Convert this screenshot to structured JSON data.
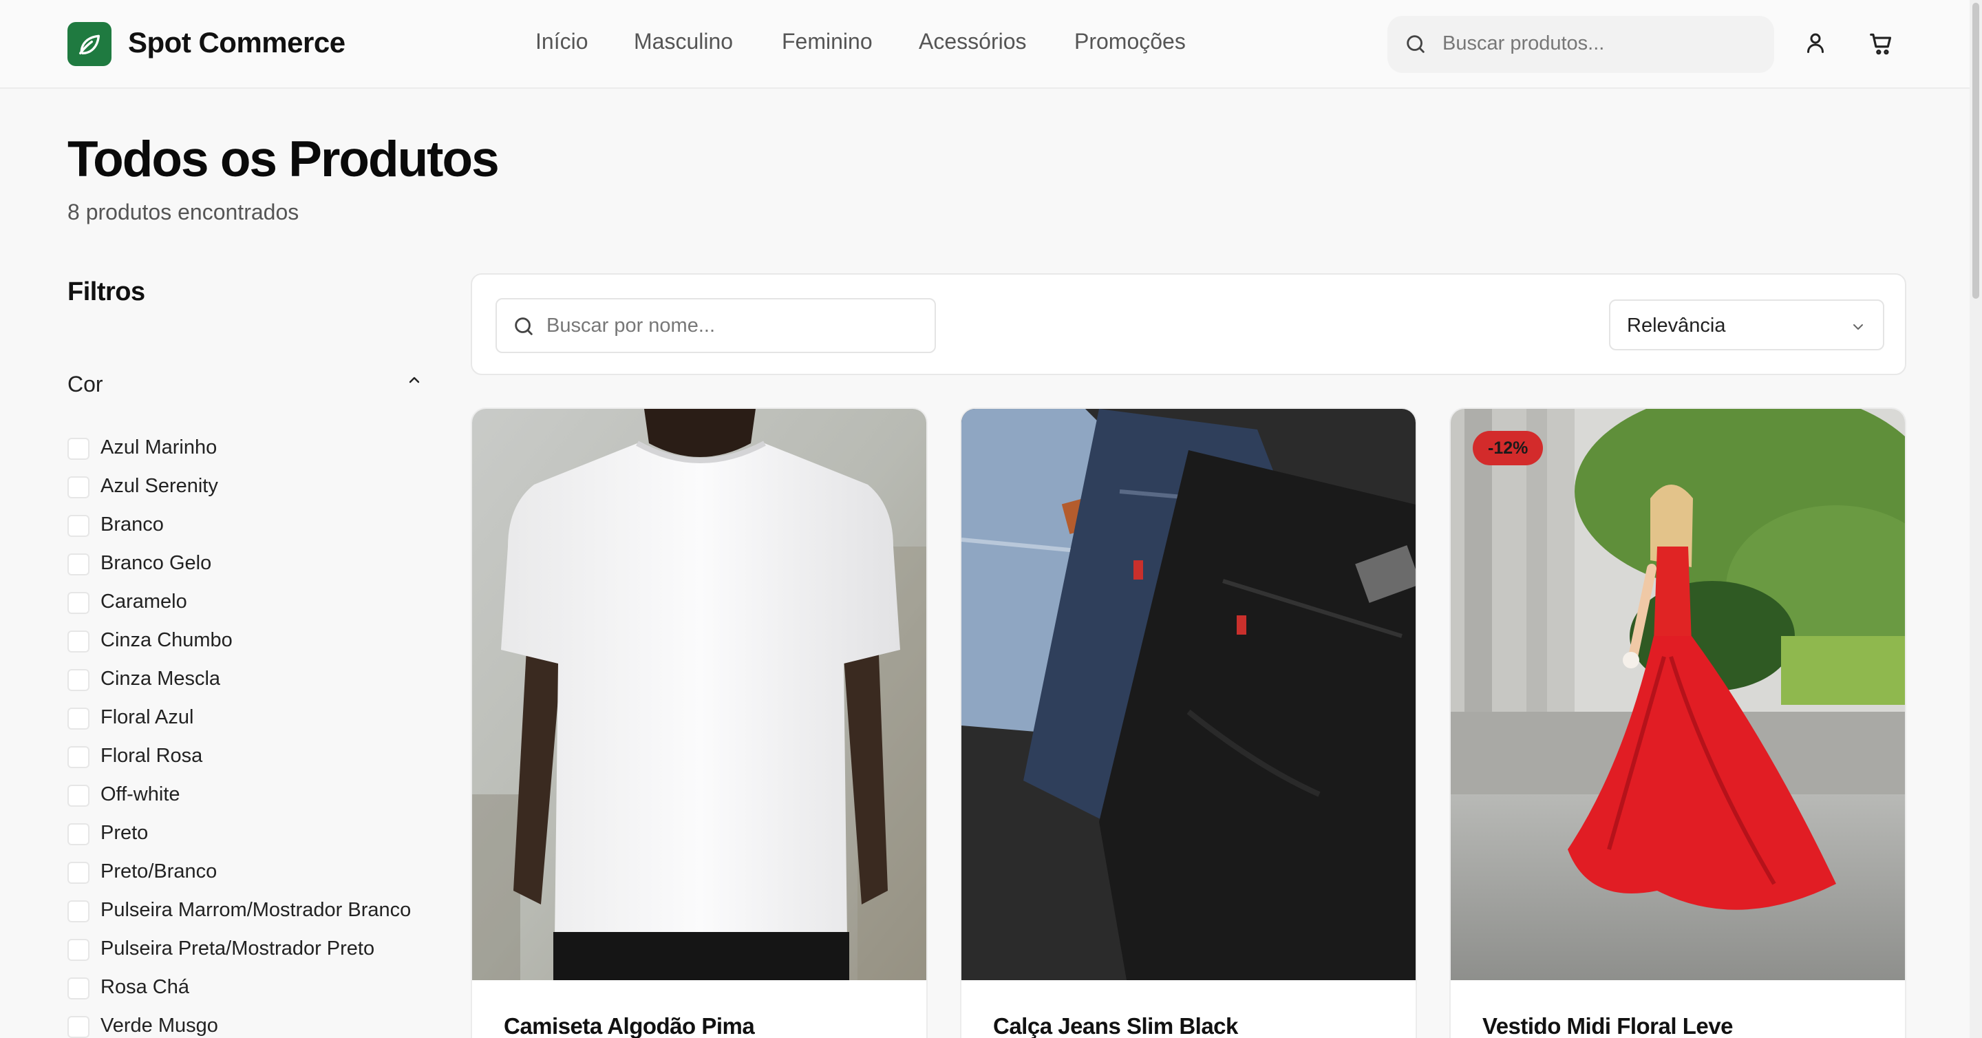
{
  "header": {
    "brand": "Spot Commerce",
    "nav": [
      "Início",
      "Masculino",
      "Feminino",
      "Acessórios",
      "Promoções"
    ],
    "search_placeholder": "Buscar produtos...",
    "icons": [
      "leaf-icon",
      "search-icon",
      "user-icon",
      "cart-icon"
    ]
  },
  "page": {
    "title": "Todos os Produtos",
    "subtitle": "8 produtos encontrados"
  },
  "filters": {
    "title": "Filtros",
    "color_section": "Cor",
    "colors": [
      "Azul Marinho",
      "Azul Serenity",
      "Branco",
      "Branco Gelo",
      "Caramelo",
      "Cinza Chumbo",
      "Cinza Mescla",
      "Floral Azul",
      "Floral Rosa",
      "Off-white",
      "Preto",
      "Preto/Branco",
      "Pulseira Marrom/Mostrador Branco",
      "Pulseira Preta/Mostrador Preto",
      "Rosa Chá",
      "Verde Musgo"
    ]
  },
  "toolbar": {
    "search_placeholder": "Buscar por nome...",
    "sort_value": "Relevância"
  },
  "products": [
    {
      "name": "Camiseta Algodão Pima",
      "badge": ""
    },
    {
      "name": "Calça Jeans Slim Black",
      "badge": ""
    },
    {
      "name": "Vestido Midi Floral Leve",
      "badge": "-12%"
    }
  ],
  "colors": {
    "brand_green": "#1f7a40",
    "discount_red": "#d32b2b"
  }
}
